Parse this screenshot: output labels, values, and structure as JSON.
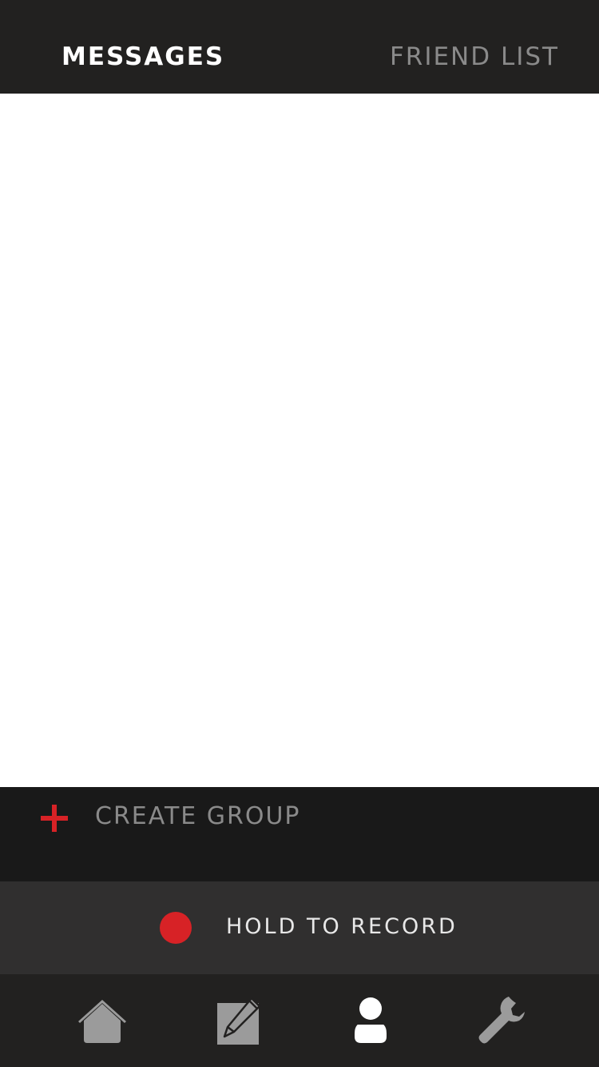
{
  "tabs": {
    "messages_label": "MESSAGES",
    "friend_list_label": "FRIEND LIST",
    "active": "messages"
  },
  "create_group": {
    "label": "CREATE GROUP",
    "icon": "plus-icon"
  },
  "record": {
    "label": "HOLD TO RECORD",
    "icon": "record-dot-icon"
  },
  "bottom_nav": {
    "items": [
      {
        "name": "home",
        "icon": "home-icon",
        "active": false
      },
      {
        "name": "compose",
        "icon": "pencil-icon",
        "active": false
      },
      {
        "name": "profile",
        "icon": "person-icon",
        "active": true
      },
      {
        "name": "settings",
        "icon": "wrench-icon",
        "active": false
      }
    ]
  },
  "colors": {
    "header_bg": "#222120",
    "create_bar_bg": "#191919",
    "record_bar_bg": "#302f2f",
    "accent_red": "#d72226",
    "inactive_gray": "#8a8a8a",
    "active_white": "#ffffff",
    "icon_gray": "#9b9b9b"
  }
}
